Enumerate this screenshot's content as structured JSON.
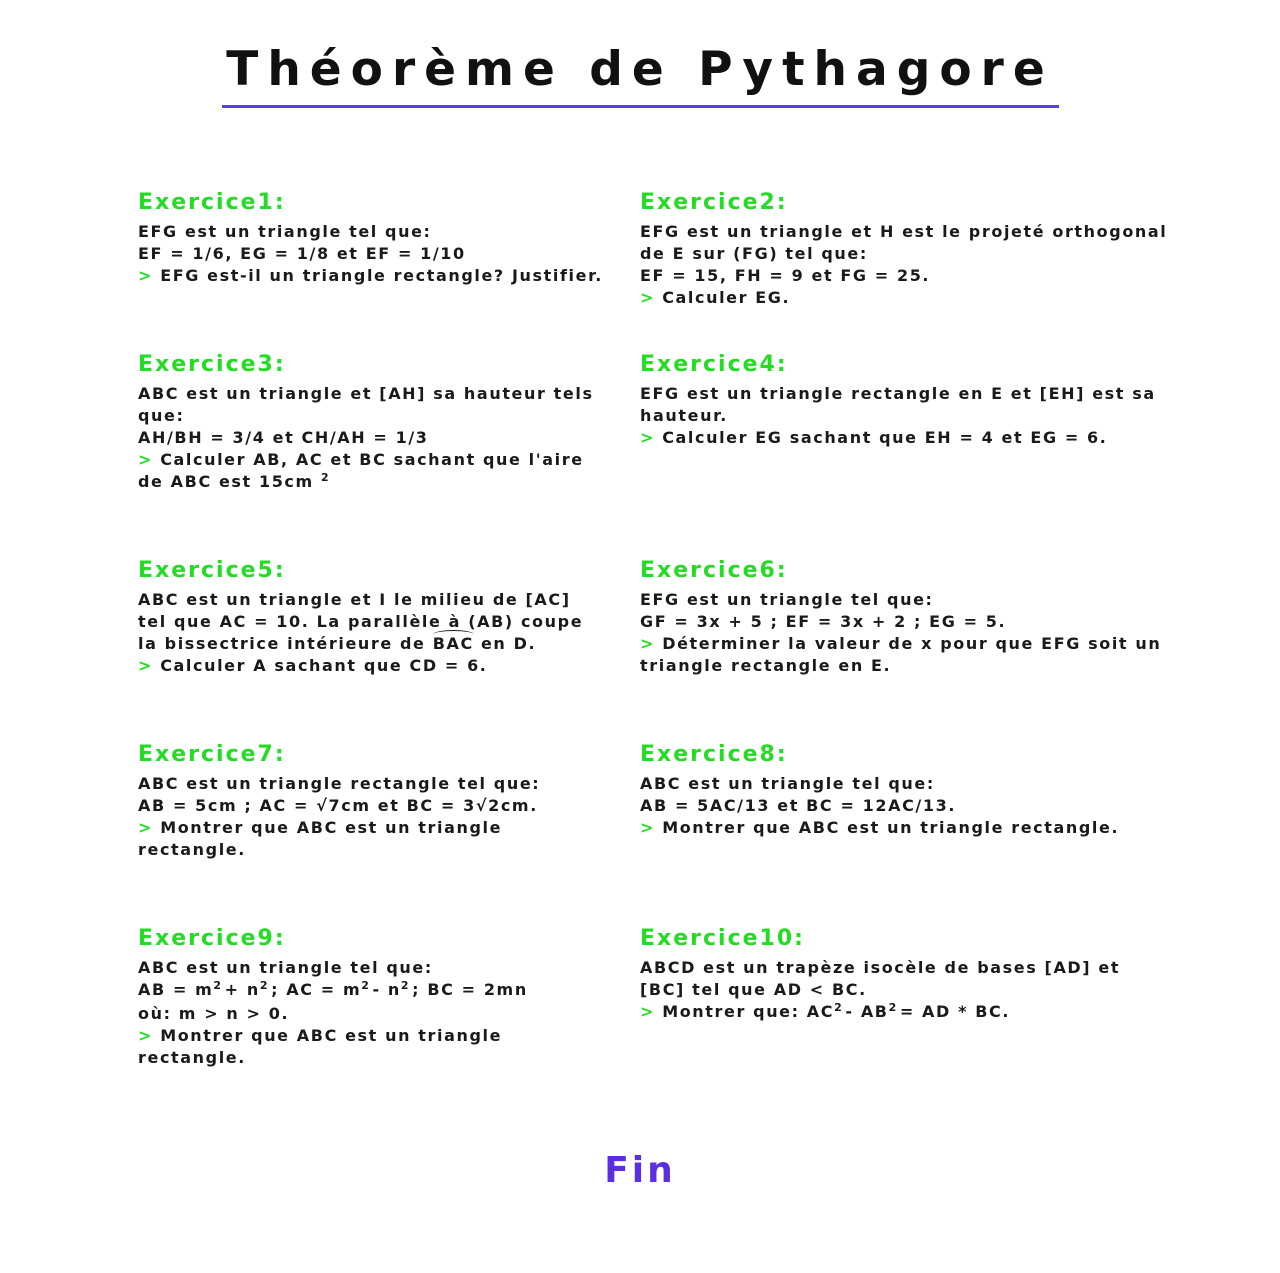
{
  "title": "Théorème de Pythagore",
  "footer": "Fin",
  "bullet": ">",
  "colors": {
    "accent_green": "#22dd22",
    "accent_purple": "#5b3fe0",
    "text": "#1a1a1a"
  },
  "exercises": [
    {
      "title": "Exercice1:",
      "lines": [
        "EFG est un triangle tel que:",
        "EF = 1/6, EG = 1/8 et EF = 1/10"
      ],
      "task": [
        "EFG est-il un triangle rectangle? Justifier."
      ]
    },
    {
      "title": "Exercice2:",
      "lines": [
        "EFG est un triangle et H est le projeté orthogonal",
        "de E sur (FG) tel que:",
        "EF = 15, FH = 9 et FG = 25."
      ],
      "task": [
        "Calculer EG."
      ]
    },
    {
      "title": "Exercice3:",
      "lines": [
        "ABC est un triangle et [AH] sa hauteur tels",
        "que:",
        "AH/BH = 3/4 et CH/AH = 1/3"
      ],
      "task": [
        "Calculer AB, AC et BC sachant que l'aire",
        "de ABC est 15cm"
      ],
      "task_sup": "2"
    },
    {
      "title": "Exercice4:",
      "lines": [
        "EFG est un triangle rectangle en E et [EH] est sa",
        "hauteur."
      ],
      "task": [
        "Calculer EG sachant que EH = 4 et EG = 6."
      ]
    },
    {
      "title": "Exercice5:",
      "lines": [
        "ABC est un triangle et I le milieu de [AC]",
        "tel que AC = 10. La parallèle à (AB) coupe"
      ],
      "line3_pre": "la bissectrice intérieure de ",
      "line3_arc": "BAC",
      "line3_post": " en D.",
      "task": [
        "Calculer A sachant que CD = 6."
      ]
    },
    {
      "title": "Exercice6:",
      "lines": [
        "EFG est un triangle tel que:",
        "GF = 3x + 5 ; EF = 3x + 2 ; EG = 5."
      ],
      "task": [
        "Déterminer la valeur de x pour que EFG soit un",
        "triangle rectangle en E."
      ]
    },
    {
      "title": "Exercice7:",
      "lines": [
        "ABC est un triangle rectangle tel que:",
        "AB = 5cm ; AC = √7cm et BC = 3√2cm."
      ],
      "task": [
        "Montrer que ABC est un triangle",
        "rectangle."
      ]
    },
    {
      "title": "Exercice8:",
      "lines": [
        "ABC est un triangle tel que:",
        "AB = 5AC/13 et BC = 12AC/13."
      ],
      "task": [
        "Montrer que ABC est un triangle rectangle."
      ]
    },
    {
      "title": "Exercice9:",
      "lines": [
        "ABC est un triangle tel que:"
      ],
      "eq": {
        "a": "AB = m",
        "b": "+ n",
        "c": "; AC = m",
        "d": "- n",
        "e": "; BC = 2mn",
        "sup": "2"
      },
      "lines2": [
        "où: m > n > 0."
      ],
      "task": [
        "Montrer que ABC est un triangle",
        "rectangle."
      ]
    },
    {
      "title": "Exercice10:",
      "lines": [
        "ABCD est un trapèze isocèle de bases [AD] et",
        "[BC] tel que AD < BC."
      ],
      "task_eq": {
        "a": "Montrer que: AC",
        "b": "- AB",
        "c": "= AD * BC.",
        "sup": "2"
      }
    }
  ]
}
